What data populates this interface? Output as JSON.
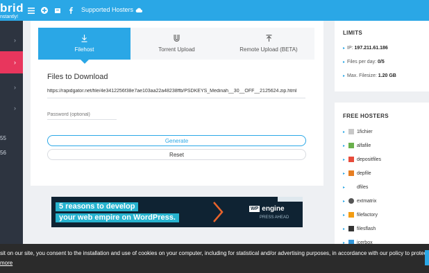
{
  "topbar": {
    "logo_main": "brid",
    "logo_sub": "nstantly!",
    "nav_link": "Supported Hosters",
    "icons": [
      "menu-icon",
      "add-icon",
      "bookmark-icon",
      "facebook-icon",
      "cloud-icon"
    ]
  },
  "sidebar": {
    "items": [
      {
        "label": "›",
        "icon": "chevron-right-icon"
      },
      {
        "label": "›",
        "icon": "chevron-right-icon"
      },
      {
        "label": "›",
        "icon": "chevron-right-icon"
      },
      {
        "label": "›",
        "icon": "chevron-right-icon"
      }
    ],
    "numbers": [
      "55",
      "56"
    ]
  },
  "tabs": [
    {
      "label": "Filehost",
      "icon": "download-icon",
      "active": true
    },
    {
      "label": "Torrent Upload",
      "icon": "magnet-icon",
      "active": false
    },
    {
      "label": "Remote Upload (BETA)",
      "icon": "upload-icon",
      "active": false
    }
  ],
  "form": {
    "title": "Files to Download",
    "url": "https://rapidgator.net/file/4e3412256f38e7ae103aa22a48238ffb/PSDKEYS_Medinah__30__OFF__2125624.zip.html",
    "password_placeholder": "Password (optional)",
    "generate_label": "Generate",
    "reset_label": "Reset"
  },
  "ad": {
    "line1": "5 reasons to develop",
    "line2": "your web empire on WordPress.",
    "brand_badge": "WP",
    "brand_name": "engine",
    "tagline": "PRESS AHEAD"
  },
  "limits": {
    "title": "LIMITS",
    "ip_label": "IP:",
    "ip_value": "197.211.61.186",
    "files_label": "Files per day:",
    "files_value": "0/5",
    "filesize_label": "Max. Filesize:",
    "filesize_value": "1.20 GB"
  },
  "free_hosters": {
    "title": "FREE HOSTERS",
    "items": [
      {
        "name": "1fichier",
        "color": "#c8c8c8"
      },
      {
        "name": "alfafile",
        "color": "#6ab04c"
      },
      {
        "name": "depositfiles",
        "color": "#e74c3c"
      },
      {
        "name": "depfile",
        "color": "#e67e22"
      },
      {
        "name": "dfiles",
        "color": "#ffffff"
      },
      {
        "name": "extmatrix",
        "color": "#555555"
      },
      {
        "name": "filefactory",
        "color": "#f39c12"
      },
      {
        "name": "filesflash",
        "color": "#333333"
      },
      {
        "name": "icerbox",
        "color": "#3498db"
      }
    ]
  },
  "cookie": {
    "text": "sit on our site, you consent to the installation and use of cookies on your computer, including for statistical and/or advertising purposes, in accordance with our policy to protect",
    "more": "more"
  },
  "colors": {
    "accent": "#2aa7e6",
    "sidebar_active": "#e8365d",
    "sidebar_bg": "#2d3440"
  }
}
